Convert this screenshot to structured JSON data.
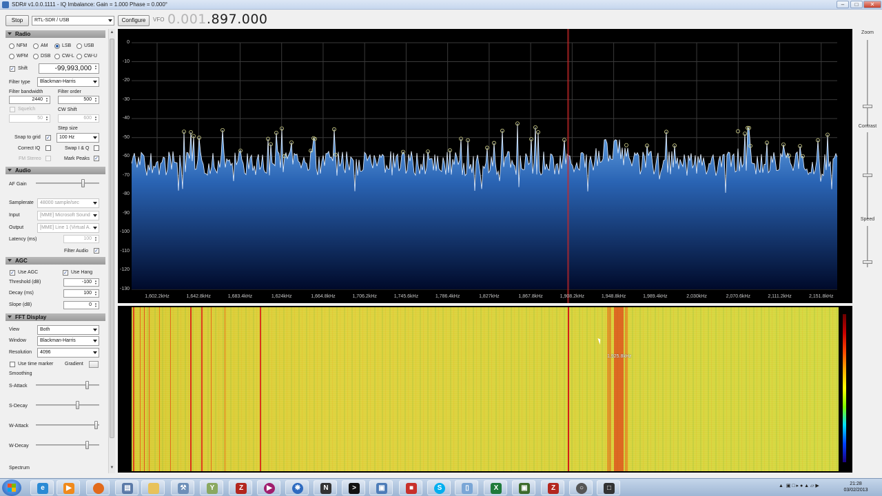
{
  "window": {
    "title": "SDR# v1.0.0.1111 - IQ Imbalance: Gain = 1.000 Phase = 0.000°"
  },
  "toolbar": {
    "stop_label": "Stop",
    "source": "RTL-SDR / USB",
    "configure_label": "Configure",
    "vfo_label": "VFO",
    "vfo_dim": "0.001",
    "vfo_value": ".897.000"
  },
  "radio": {
    "header": "Radio",
    "modes": [
      "NFM",
      "AM",
      "LSB",
      "USB",
      "WFM",
      "DSB",
      "CW-L",
      "CW-U"
    ],
    "selected_mode": "LSB",
    "shift_label": "Shift",
    "shift_value": "-99,993,000",
    "filter_type_label": "Filter type",
    "filter_type": "Blackman-Harris",
    "filter_bandwidth_label": "Filter bandwidth",
    "filter_bandwidth": "2440",
    "filter_order_label": "Filter order",
    "filter_order": "500",
    "squelch_label": "Squelch",
    "squelch_value": "50",
    "cw_shift_label": "CW Shift",
    "cw_shift_value": "600",
    "step_size_label": "Step size",
    "step_size": "100 Hz",
    "snap_label": "Snap to grid",
    "correct_iq_label": "Correct IQ",
    "swap_iq_label": "Swap I & Q",
    "fm_stereo_label": "FM Stereo",
    "mark_peaks_label": "Mark Peaks"
  },
  "audio": {
    "header": "Audio",
    "af_gain_label": "AF Gain",
    "af_gain": 0.78,
    "samplerate_label": "Samplerate",
    "samplerate": "48000 sample/sec",
    "input_label": "Input",
    "input": "[MME] Microsoft Sound",
    "output_label": "Output",
    "output": "[MME] Line 1 (Virtual A.",
    "latency_label": "Latency (ms)",
    "latency": "100",
    "filter_audio_label": "Filter Audio"
  },
  "agc": {
    "header": "AGC",
    "use_agc_label": "Use AGC",
    "use_hang_label": "Use Hang",
    "threshold_label": "Threshold (dB)",
    "threshold": "-100",
    "decay_label": "Decay (ms)",
    "decay": "100",
    "slope_label": "Slope (dB)",
    "slope": "0"
  },
  "fft": {
    "header": "FFT Display",
    "view_label": "View",
    "view": "Both",
    "window_label": "Window",
    "window": "Blackman-Harris",
    "resolution_label": "Resolution",
    "resolution": "4096",
    "time_marker_label": "Use time marker",
    "gradient_label": "Gradient",
    "smoothing_label": "Smoothing",
    "s_attack_label": "S-Attack",
    "s_decay_label": "S-Decay",
    "w_attack_label": "W-Attack",
    "w_decay_label": "W-Decay",
    "s_attack": 0.85,
    "s_decay": 0.68,
    "w_attack": 1.0,
    "w_decay": 0.85,
    "spectrum_label": "Spectrum"
  },
  "spectrum": {
    "db_ticks": [
      "0",
      "-10",
      "-20",
      "-30",
      "-40",
      "-50",
      "-60",
      "-70",
      "-80",
      "-90",
      "-100",
      "-110",
      "-120",
      "-130"
    ],
    "freq_ticks": [
      "1,602.2kHz",
      "1,642.8kHz",
      "1,683.4kHz",
      "1,624kHz",
      "1,664.8kHz",
      "1,706.2kHz",
      "1,745.6kHz",
      "1,786.4kHz",
      "1,827kHz",
      "1,867.8kHz",
      "1,908.2kHz",
      "1,948.8kHz",
      "1,989.4kHz",
      "2,030kHz",
      "2,070.6kHz",
      "2,111.2kHz",
      "2,151.8kHz"
    ]
  },
  "waterfall": {
    "cursor_label": "1,925.8kHz"
  },
  "right_panel": {
    "zoom_label": "Zoom",
    "contrast_label": "Contrast",
    "speed_label": "Speed",
    "zoom": 0.2,
    "contrast": 0.5,
    "speed": 0.05
  },
  "taskbar": {
    "time": "21:28",
    "date": "03/02/2013"
  }
}
